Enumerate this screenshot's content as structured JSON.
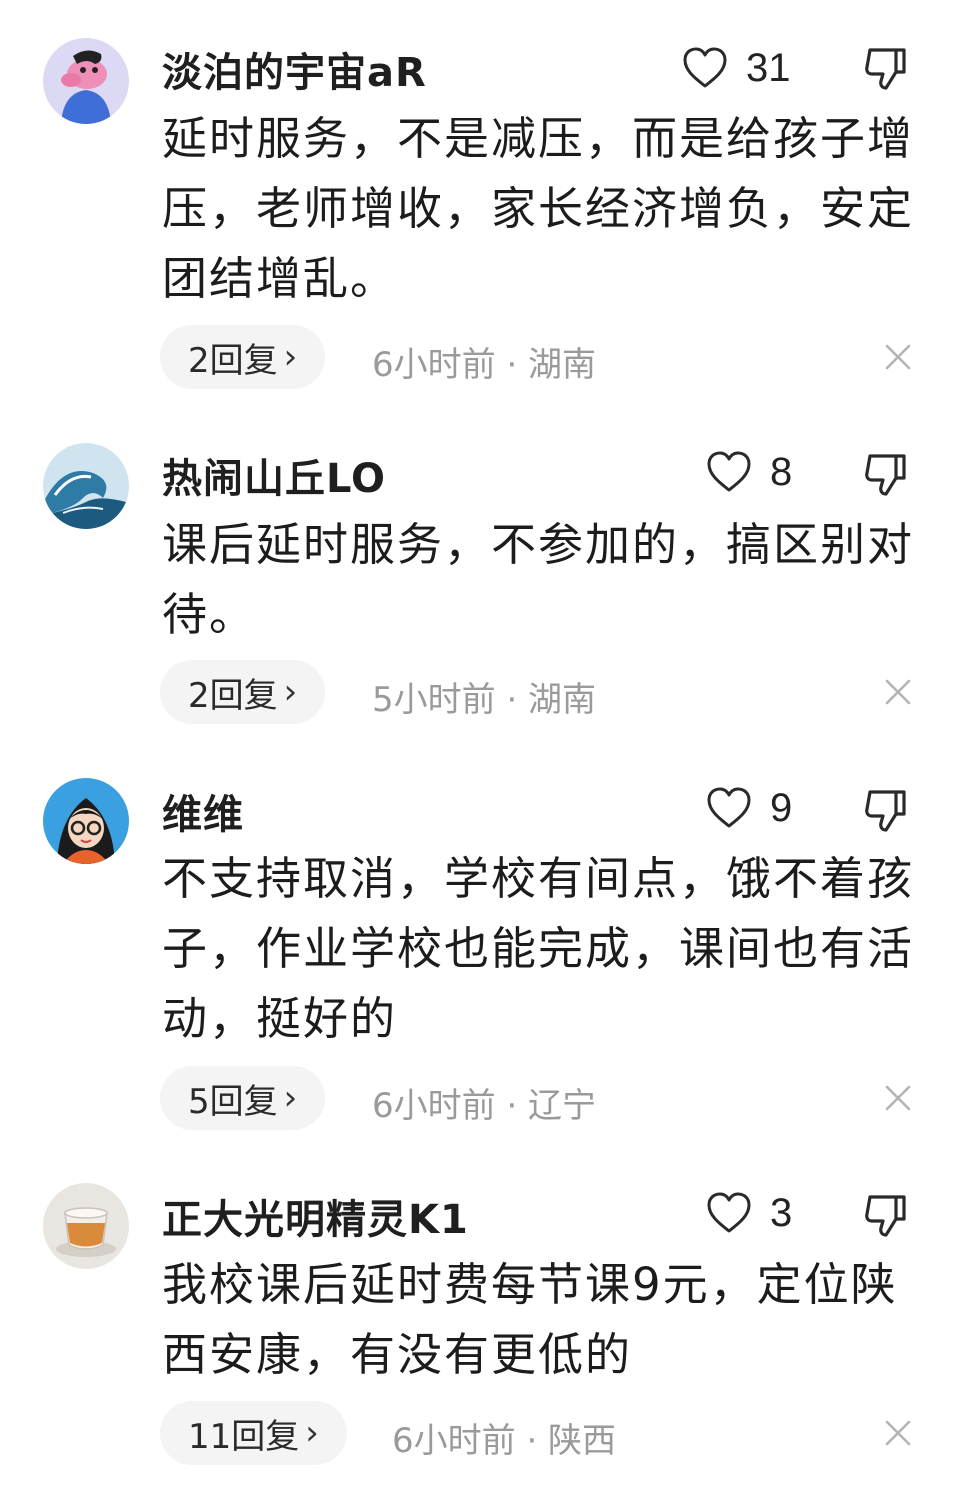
{
  "comments": [
    {
      "username": "淡泊的宇宙aR",
      "avatar_icon": "pink-cartoon-avatar-icon",
      "likes": "31",
      "text": "延时服务，不是减压，而是给孩子增压，老师增收，家长经济增负，安定团结增乱。",
      "reply_count": "2回复",
      "time": "6小时前",
      "location": "湖南",
      "meta": "6小时前 · 湖南"
    },
    {
      "username": "热闹山丘LO",
      "avatar_icon": "ocean-wave-avatar-icon",
      "likes": "8",
      "text": "课后延时服务，不参加的，搞区别对待。",
      "reply_count": "2回复",
      "time": "5小时前",
      "location": "湖南",
      "meta": "5小时前 · 湖南"
    },
    {
      "username": "维维",
      "avatar_icon": "cartoon-girl-glasses-avatar-icon",
      "likes": "9",
      "text": "不支持取消，学校有间点，饿不着孩子，作业学校也能完成，课间也有活动，挺好的",
      "reply_count": "5回复",
      "time": "6小时前",
      "location": "辽宁",
      "meta": "6小时前 · 辽宁"
    },
    {
      "username": "正大光明精灵K1",
      "avatar_icon": "tea-cup-avatar-icon",
      "likes": "3",
      "text": "我校课后延时费每节课9元，定位陕西安康，有没有更低的",
      "reply_count": "11回复",
      "time": "6小时前",
      "location": "陕西",
      "meta": "6小时前 · 陕西"
    }
  ],
  "icons": {
    "like": "heart-outline-icon",
    "dislike": "thumbs-down-outline-icon",
    "reply_chevron": "chevron-right-icon",
    "dismiss": "close-icon"
  },
  "colors": {
    "text": "#1c1c1c",
    "meta": "#9a9a9a",
    "pill_bg": "#f4f4f4"
  }
}
